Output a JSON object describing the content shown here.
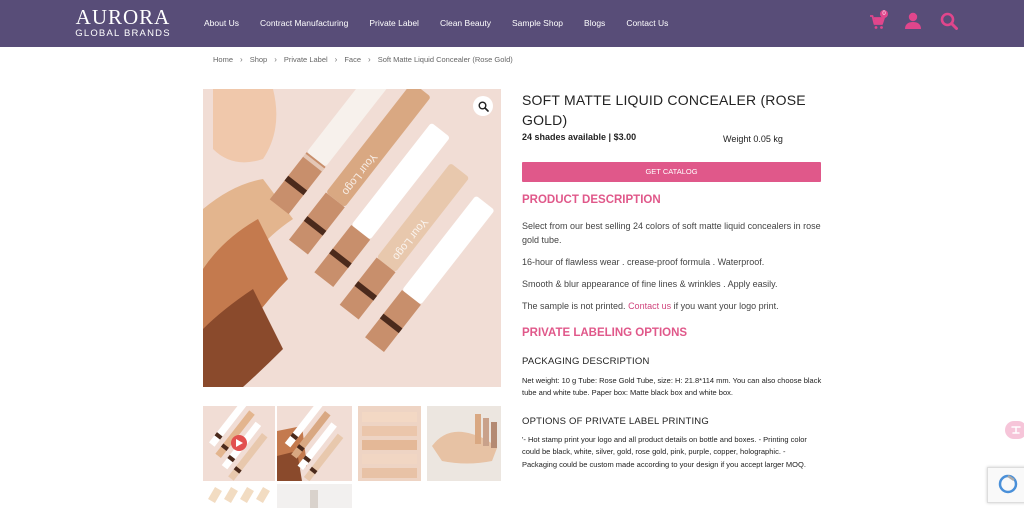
{
  "header": {
    "logo_main": "AURORA",
    "logo_sub": "GLOBAL BRANDS",
    "nav": [
      "About Us",
      "Contract Manufacturing",
      "Private Label",
      "Clean Beauty",
      "Sample Shop",
      "Blogs",
      "Contact Us"
    ],
    "cart_count": "0"
  },
  "breadcrumb": [
    "Home",
    "Shop",
    "Private Label",
    "Face",
    "Soft Matte Liquid Concealer (Rose Gold)"
  ],
  "product": {
    "title": "SOFT MATTE LIQUID CONCEALER (ROSE GOLD)",
    "price_line": "24 shades available | $3.00",
    "weight": "Weight  0.05 kg",
    "catalog_button": "GET CATALOG",
    "product_image_text_1": "Your Logo",
    "product_image_text_2": "Your Logo"
  },
  "description": {
    "title": "PRODUCT DESCRIPTION",
    "p1": "Select from our best selling 24 colors of soft matte liquid concealers in rose gold tube.",
    "p2": "16-hour of flawless wear . crease-proof formula . Waterproof.",
    "p3": "Smooth & blur appearance of fine lines & wrinkles . Apply easily.",
    "p4_before": "The sample is not printed. ",
    "p4_link": "Contact us",
    "p4_after": " if you want your logo print."
  },
  "private_label": {
    "title": "PRIVATE LABELING OPTIONS",
    "packaging_heading": "PACKAGING DESCRIPTION",
    "packaging_text": "Net weight: 10 g Tube: Rose Gold Tube, size: H: 21.8*114 mm. You can also choose black tube and white tube. Paper box: Matte black box and white box.",
    "printing_heading": "OPTIONS OF PRIVATE LABEL PRINTING",
    "printing_text": "'- Hot stamp print your logo and all product details on bottle and boxes. - Printing color could be black, white, silver, gold, rose gold, pink, purple, copper, holographic. - Packaging could be custom made according to your design if you accept larger MOQ."
  },
  "colors": {
    "header_bg": "#584d78",
    "accent": "#e0588a"
  }
}
